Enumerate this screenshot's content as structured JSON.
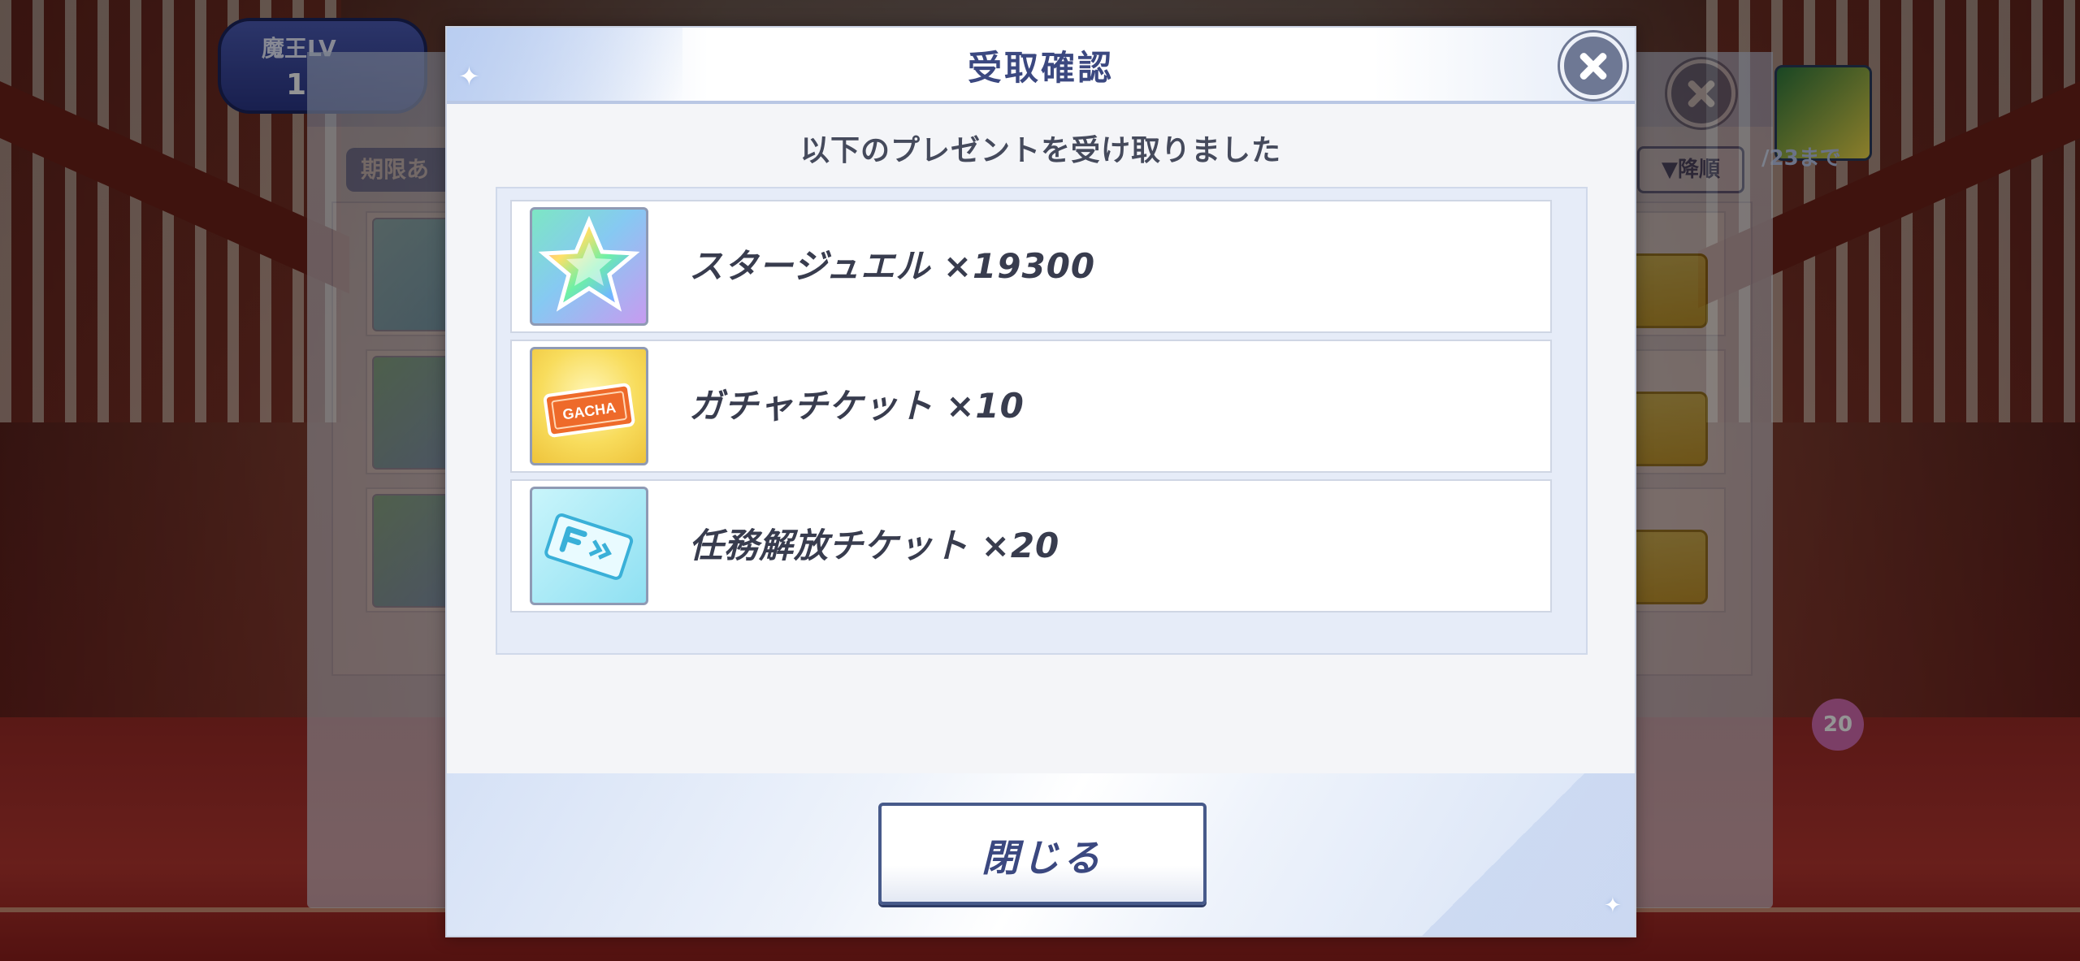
{
  "background": {
    "hud": {
      "level_label": "魔王LV",
      "level_value": "1"
    },
    "panel": {
      "tab_label": "期限あ",
      "sort_label": "▼降順"
    },
    "banner_date": "/23まで",
    "present_count": "20"
  },
  "modal": {
    "title": "受取確認",
    "subtitle": "以下のプレゼントを受け取りました",
    "items": [
      {
        "icon": "star-jewel-icon",
        "label": "スタージュエル ×19300"
      },
      {
        "icon": "gacha-ticket-icon",
        "label": "ガチャチケット ×10"
      },
      {
        "icon": "mission-ticket-icon",
        "label": "任務解放チケット ×20"
      }
    ],
    "gacha_icon_text": "GACHA",
    "close_button_label": "閉じる"
  },
  "colors": {
    "title_text": "#3b4880",
    "close_button_border": "#475a8a",
    "item_text": "#383c4e"
  }
}
